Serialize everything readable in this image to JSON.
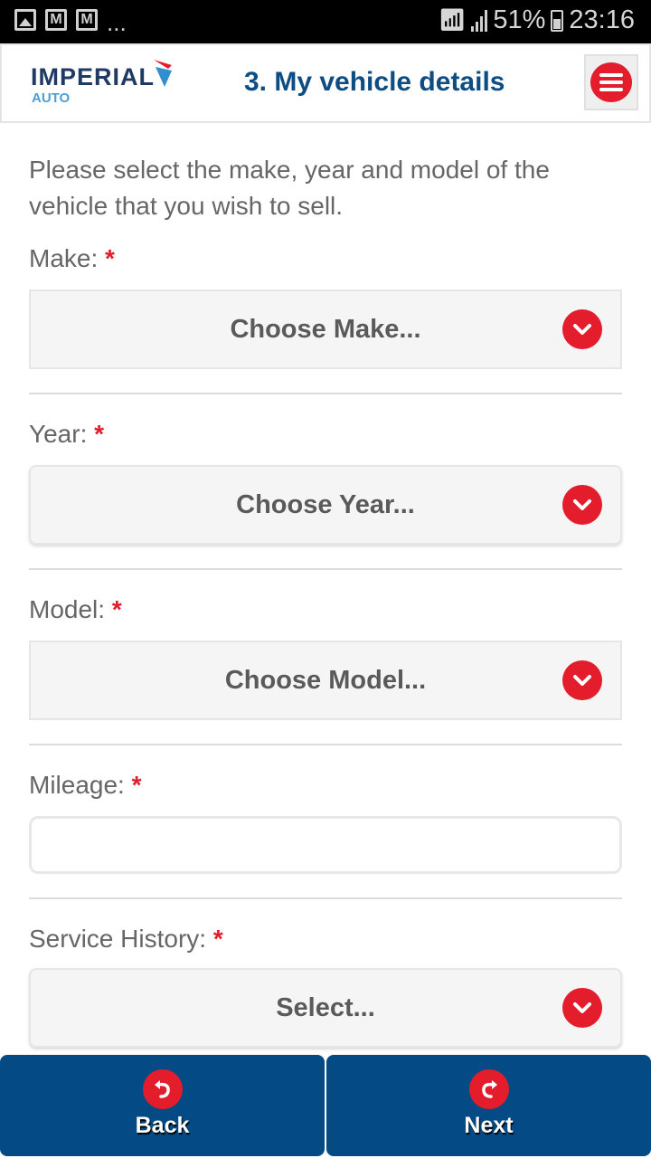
{
  "status_bar": {
    "battery": "51%",
    "time": "23:16",
    "notification_overflow": "...",
    "icons": [
      "image-icon",
      "gmail-icon",
      "gmail-icon",
      "wifi-icon",
      "signal-icon",
      "battery-icon"
    ]
  },
  "header": {
    "logo_main": "IMPERIAL",
    "logo_sub": "AUTO",
    "title": "3. My vehicle details",
    "menu_icon": "hamburger-menu-icon"
  },
  "form": {
    "intro": "Please select the make, year and model of the vehicle that you wish to sell.",
    "required_marker": "*",
    "fields": [
      {
        "label": "Make:",
        "type": "select",
        "value": "Choose Make..."
      },
      {
        "label": "Year:",
        "type": "select",
        "value": "Choose Year..."
      },
      {
        "label": "Model:",
        "type": "select",
        "value": "Choose Model..."
      },
      {
        "label": "Mileage:",
        "type": "text",
        "value": "",
        "placeholder": ""
      },
      {
        "label": "Service History:",
        "type": "select",
        "value": "Select..."
      }
    ]
  },
  "footer": {
    "back_label": "Back",
    "next_label": "Next"
  },
  "colors": {
    "brand_blue": "#044a84",
    "title_blue": "#0d4d84",
    "accent_red": "#e31d2b"
  }
}
